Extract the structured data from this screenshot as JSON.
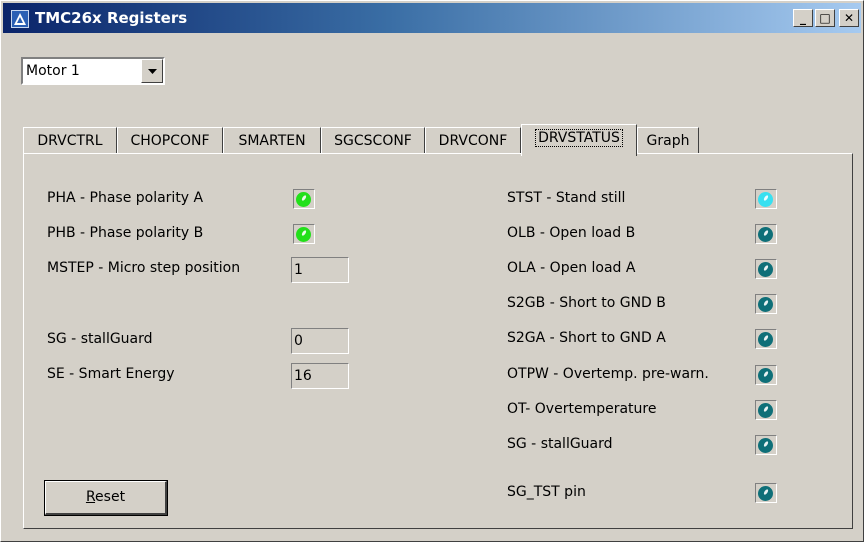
{
  "window": {
    "title": "TMC26x Registers",
    "controls": {
      "minimize": "_",
      "maximize": "□",
      "close": "✕"
    }
  },
  "motor_select": {
    "value": "Motor 1"
  },
  "tabs": [
    {
      "label": "DRVCTRL",
      "active": false
    },
    {
      "label": "CHOPCONF",
      "active": false
    },
    {
      "label": "SMARTEN",
      "active": false
    },
    {
      "label": "SGCSCONF",
      "active": false
    },
    {
      "label": "DRVCONF",
      "active": false
    },
    {
      "label": "DRVSTATUS",
      "active": true
    },
    {
      "label": "Graph",
      "active": false
    }
  ],
  "left": {
    "pha": {
      "label": "PHA - Phase polarity A",
      "state": "on"
    },
    "phb": {
      "label": "PHB - Phase polarity B",
      "state": "on"
    },
    "mstep": {
      "label": "MSTEP - Micro step position",
      "value": "1"
    },
    "sg": {
      "label": "SG - stallGuard",
      "value": "0"
    },
    "se": {
      "label": "SE - Smart Energy",
      "value": "16"
    }
  },
  "right": [
    {
      "label": "STST - Stand still",
      "state": "on"
    },
    {
      "label": "OLB - Open load B",
      "state": "off"
    },
    {
      "label": "OLA - Open load A",
      "state": "off"
    },
    {
      "label": "S2GB - Short to GND B",
      "state": "off"
    },
    {
      "label": "S2GA - Short to GND A",
      "state": "off"
    },
    {
      "label": "OTPW - Overtemp. pre-warn.",
      "state": "off"
    },
    {
      "label": "OT- Overtemperature",
      "state": "off"
    },
    {
      "label": "SG - stallGuard",
      "state": "off"
    },
    {
      "label": "SG_TST pin",
      "state": "off"
    }
  ],
  "reset_button": {
    "label_prefix": "R",
    "label_rest": "eset"
  },
  "colors": {
    "led_green": "#22e01a",
    "led_cyan": "#38e0f0",
    "led_teal": "#0e6f78"
  }
}
